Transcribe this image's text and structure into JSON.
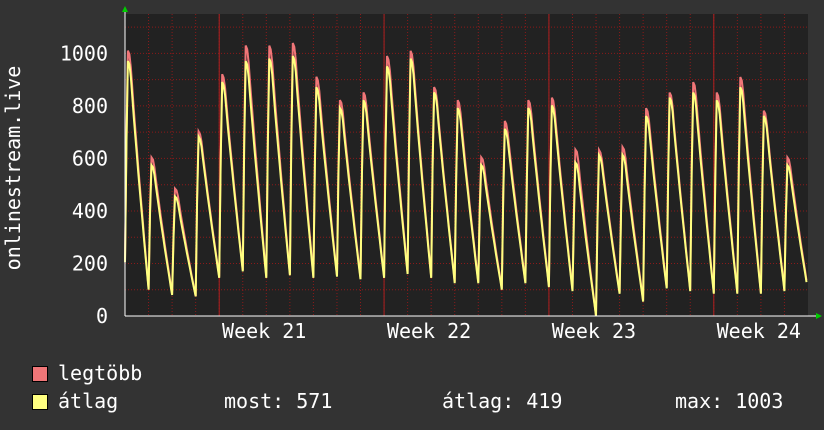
{
  "chart_data": {
    "type": "line",
    "ylabel": "onlinestream.live",
    "ylim": [
      0,
      1150
    ],
    "yticks": [
      0,
      200,
      400,
      600,
      800,
      1000
    ],
    "xlabels": [
      "Week  21",
      "Week  22",
      "Week  23",
      "Week  24"
    ],
    "grid": true,
    "background_color": "#222222",
    "grid_color": "#8b1a1a",
    "axis_color": "#ffffff",
    "series": [
      {
        "name": "legtöbb",
        "color": "#f07678",
        "daily_peaks": [
          1020,
          610,
          490,
          710,
          930,
          1040,
          1040,
          1050,
          920,
          830,
          860,
          1000,
          1020,
          880,
          830,
          610,
          750,
          830,
          840,
          640,
          640,
          650,
          800,
          860,
          900,
          860,
          920,
          790,
          610
        ],
        "daily_troughs": [
          210,
          105,
          85,
          75,
          150,
          175,
          150,
          160,
          150,
          155,
          145,
          150,
          165,
          150,
          130,
          130,
          105,
          130,
          115,
          100,
          0,
          90,
          60,
          110,
          100,
          90,
          90,
          90,
          100
        ]
      },
      {
        "name": "átlag",
        "color": "#ffff80",
        "daily_peaks": [
          980,
          580,
          460,
          690,
          900,
          980,
          990,
          1000,
          880,
          800,
          830,
          960,
          990,
          860,
          800,
          580,
          720,
          800,
          810,
          590,
          620,
          620,
          770,
          840,
          860,
          830,
          880,
          770,
          580
        ],
        "daily_troughs": [
          205,
          100,
          80,
          75,
          145,
          170,
          145,
          155,
          145,
          150,
          140,
          145,
          160,
          145,
          125,
          125,
          100,
          125,
          110,
          95,
          0,
          85,
          55,
          105,
          95,
          85,
          85,
          85,
          95
        ]
      }
    ]
  },
  "legend": {
    "max_label": "legtöbb",
    "avg_label": "átlag",
    "now_text": "most: 571",
    "avg_text": "átlag: 419",
    "max_text": "max: 1003"
  }
}
